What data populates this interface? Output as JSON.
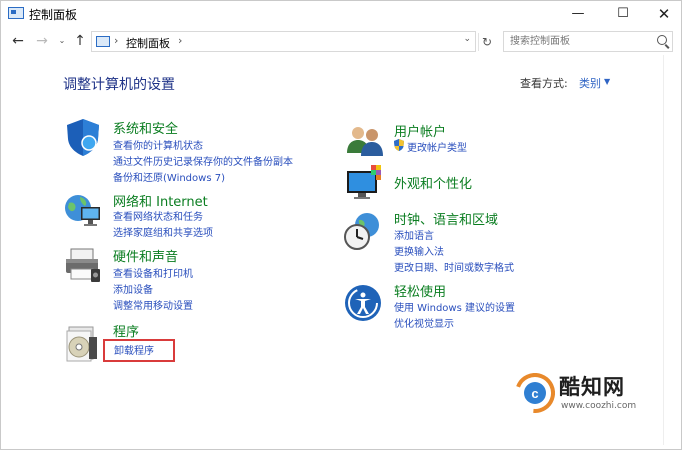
{
  "window": {
    "title": "控制面板",
    "controls": {
      "minimize": "—",
      "maximize": "☐",
      "close": "✕"
    }
  },
  "nav": {
    "back": "←",
    "forward": "→",
    "recent": "⌄",
    "up": "↑",
    "breadcrumb": "控制面板",
    "separator": "›",
    "dropdown": "⌄",
    "refresh": "↻"
  },
  "search": {
    "placeholder": "搜索控制面板"
  },
  "main": {
    "title": "调整计算机的设置",
    "view_by_label": "查看方式:",
    "view_by_value": "类别",
    "view_by_arrow": "▼"
  },
  "categories": {
    "system_security": {
      "title": "系统和安全",
      "links": [
        "查看你的计算机状态",
        "通过文件历史记录保存你的文件备份副本",
        "备份和还原(Windows 7)"
      ]
    },
    "network": {
      "title": "网络和 Internet",
      "links": [
        "查看网络状态和任务",
        "选择家庭组和共享选项"
      ]
    },
    "hardware_sound": {
      "title": "硬件和声音",
      "links": [
        "查看设备和打印机",
        "添加设备",
        "调整常用移动设置"
      ]
    },
    "programs": {
      "title": "程序",
      "links": [
        "卸载程序"
      ]
    },
    "user_accounts": {
      "title": "用户帐户",
      "links": [
        "更改帐户类型"
      ]
    },
    "appearance": {
      "title": "外观和个性化",
      "links": []
    },
    "clock_language": {
      "title": "时钟、语言和区域",
      "links": [
        "添加语言",
        "更换输入法",
        "更改日期、时间或数字格式"
      ]
    },
    "ease_of_access": {
      "title": "轻松使用",
      "links": [
        "使用 Windows 建议的设置",
        "优化视觉显示"
      ]
    }
  },
  "watermark": {
    "name": "酷知网",
    "url": "www.coozhi.com"
  },
  "colors": {
    "category_title": "#0a7d20",
    "link": "#2a4fbd",
    "page_title": "#1e3287",
    "highlight": "#d93b3b"
  }
}
